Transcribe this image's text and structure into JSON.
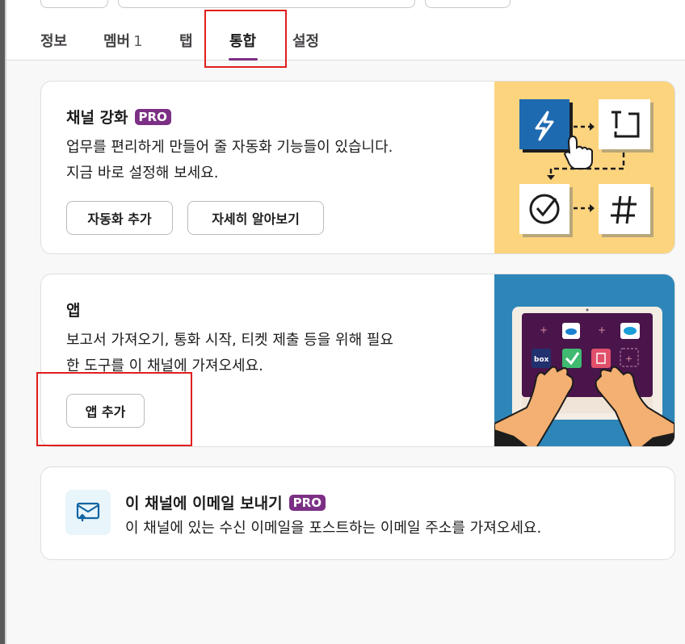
{
  "tabs": [
    {
      "label": "정보",
      "count": ""
    },
    {
      "label": "멤버",
      "count": "1"
    },
    {
      "label": "탭",
      "count": ""
    },
    {
      "label": "통합",
      "count": ""
    },
    {
      "label": "설정",
      "count": ""
    }
  ],
  "active_tab": "통합",
  "workflow": {
    "title": "채널 강화",
    "badge": "PRO",
    "desc_line1": "업무를 편리하게 만들어 줄 자동화 기능들이 있습니다.",
    "desc_line2": "지금 바로 설정해 보세요.",
    "add_button": "자동화 추가",
    "learn_button": "자세히 알아보기"
  },
  "apps": {
    "title": "앱",
    "desc_line1": "보고서 가져오기, 통화 시작, 티켓 제출 등을 위해 필요",
    "desc_line2": "한 도구를 이 채널에 가져오세요.",
    "add_button": "앱 추가",
    "box_label": "box"
  },
  "email": {
    "title": "이 채널에 이메일 보내기",
    "badge": "PRO",
    "desc": "이 채널에 있는 수신 이메일을 포스트하는 이메일 주소를 가져오세요."
  },
  "colors": {
    "accent_purple": "#7c3085",
    "highlight_red": "#e01e1e",
    "illustration_yellow": "#fcd47e",
    "illustration_blue": "#2e86b8",
    "laptop_purple": "#4a154b"
  },
  "icons": [
    "lightning-icon",
    "text-icon",
    "check-circle-icon",
    "hash-icon",
    "email-icon"
  ]
}
